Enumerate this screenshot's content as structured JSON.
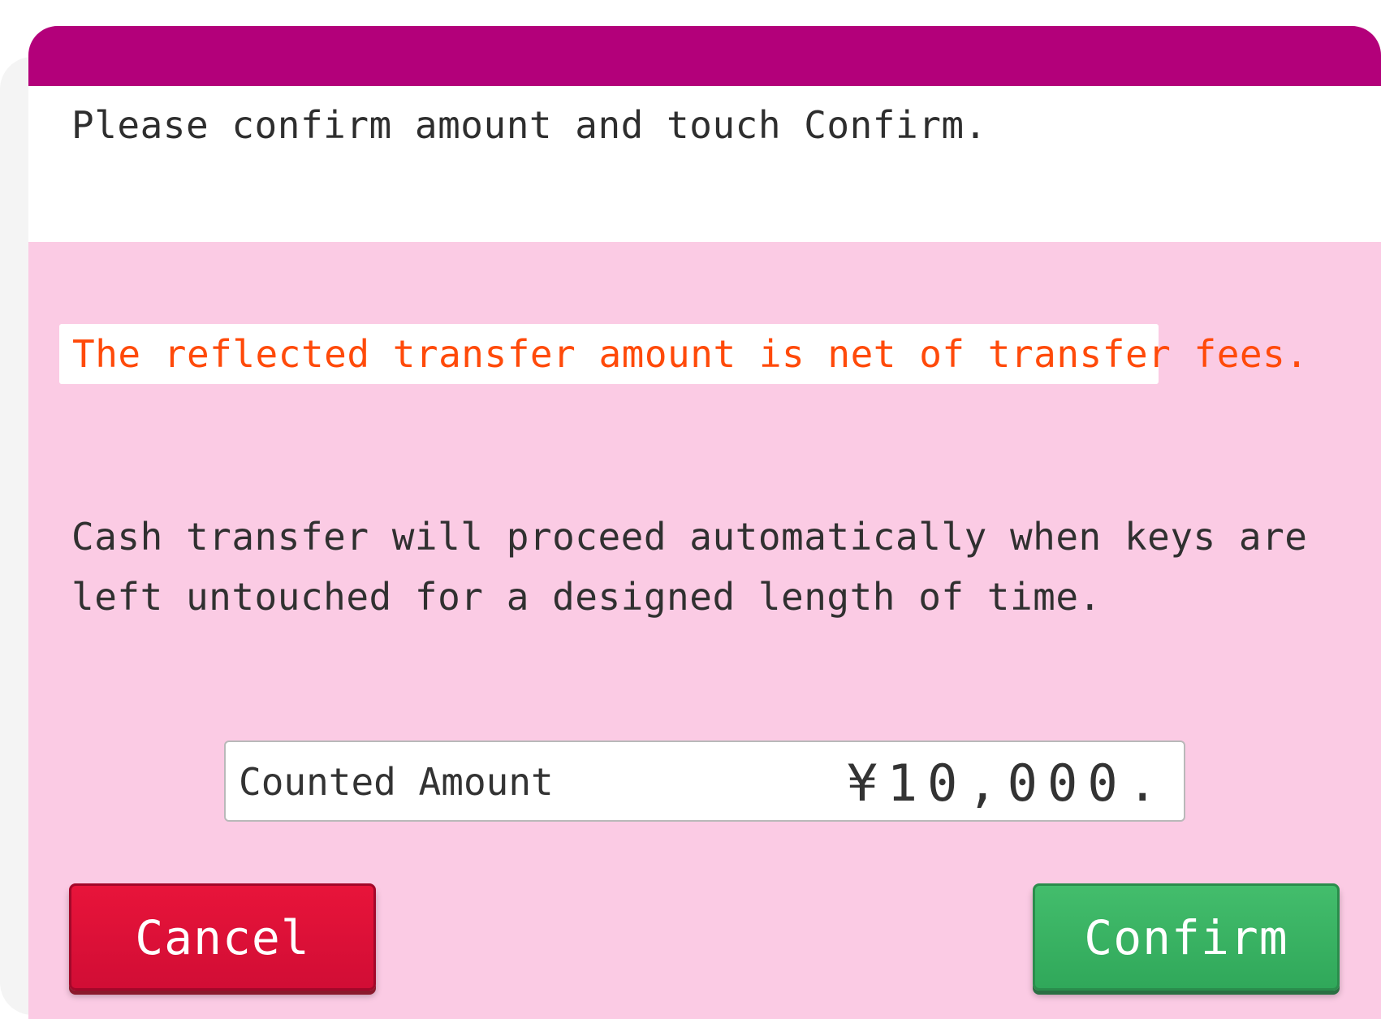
{
  "header": {
    "title": "",
    "color": "#b3007a"
  },
  "instruction": {
    "text": "Please confirm amount and touch Confirm."
  },
  "notice": {
    "text": "The reflected transfer amount is net of transfer fees.",
    "color": "#ff4a0a"
  },
  "info": {
    "text": "Cash transfer will proceed automatically when keys are left untouched for a designed length of time."
  },
  "amount": {
    "label": "Counted Amount",
    "value": "¥10,000."
  },
  "buttons": {
    "cancel_label": "Cancel",
    "confirm_label": "Confirm",
    "cancel_color": "#e01036",
    "confirm_color": "#3ab464"
  },
  "background_color": "#fbcbe4"
}
